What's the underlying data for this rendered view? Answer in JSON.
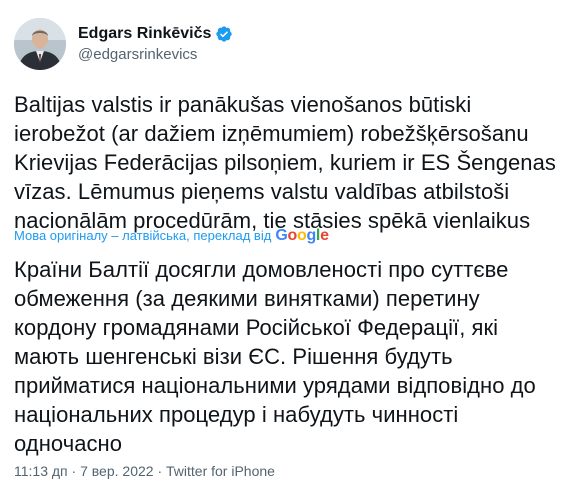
{
  "author": {
    "name": "Edgars Rinkēvičs",
    "handle": "@edgarsrinkevics",
    "verified": true
  },
  "tweet": {
    "original_text": "Baltijas valstis ir panākušas vienošanos būtiski\nierobežot (ar dažiem izņēmumiem)  robežšķērsošanu\nKrievijas Federācijas pilsoņiem, kuriem ir ES Šengenas\nvīzas. Lēmumus pieņems valstu valdības atbilstoši\nnacionālām procedūrām, tie stāsies spēkā vienlaikus",
    "translation_note": "Мова оригіналу – латвійська, переклад від",
    "translation_provider": "Google",
    "translated_text": "Країни Балтії досягли домовленості про суттєве\nобмеження (за деякими винятками) перетину\nкордону громадянами Російської Федерації, які\nмають шенгенські візи ЄС. Рішення будуть\nприйматися національними урядами відповідно до\nнаціональних процедур і набудуть чинності\nодночасно",
    "time": "11:13 дп",
    "date": "7 вер. 2022",
    "separator": "·",
    "source": "Twitter for iPhone"
  },
  "colors": {
    "text": "#0f1419",
    "secondary": "#536471",
    "accent": "#1d9bf0",
    "google_blue": "#4285F4",
    "google_red": "#EA4335",
    "google_yellow": "#FBBC05",
    "google_green": "#34A853"
  },
  "icons": {
    "verified": "verified-badge-icon",
    "avatar": "profile-photo"
  }
}
